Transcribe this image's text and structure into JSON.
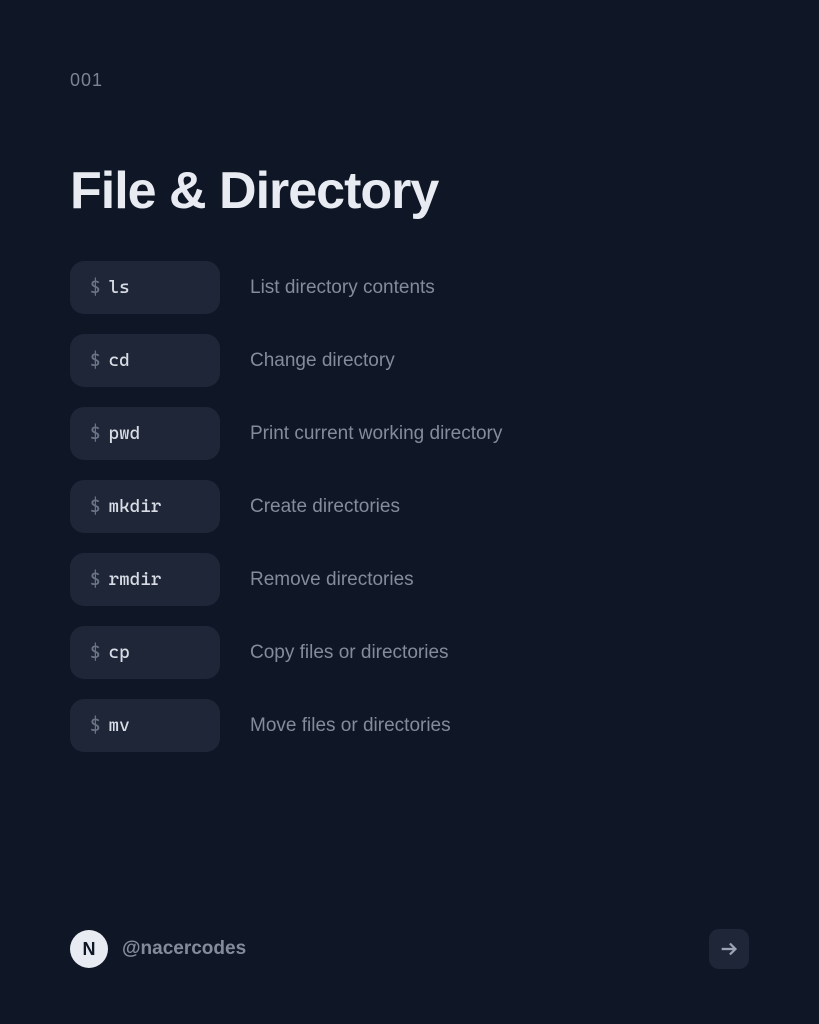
{
  "page_number": "001",
  "title": "File & Directory",
  "prompt_symbol": "$",
  "commands": [
    {
      "cmd": "ls",
      "desc": "List directory contents"
    },
    {
      "cmd": "cd",
      "desc": "Change directory"
    },
    {
      "cmd": "pwd",
      "desc": "Print current working directory"
    },
    {
      "cmd": "mkdir",
      "desc": "Create directories"
    },
    {
      "cmd": "rmdir",
      "desc": "Remove directories"
    },
    {
      "cmd": "cp",
      "desc": "Copy files or directories"
    },
    {
      "cmd": "mv",
      "desc": "Move files or directories"
    }
  ],
  "footer": {
    "avatar_letter": "N",
    "handle": "@nacercodes"
  }
}
